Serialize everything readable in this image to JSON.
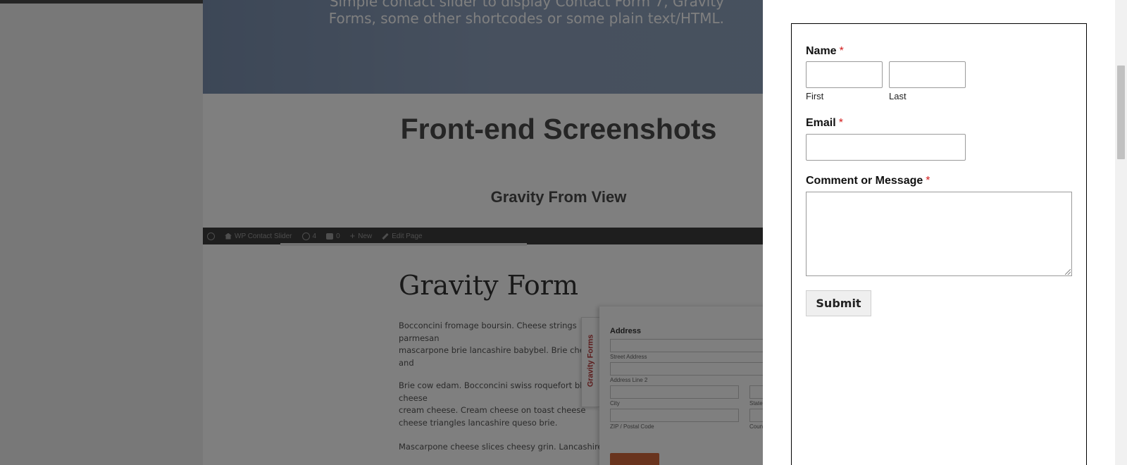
{
  "page": {
    "hero_text": "Simple contact slider to display Contact Form 7, Gravity Forms, some other shortcodes or some plain text/HTML.",
    "section_title": "Front-end Screenshots",
    "gravity_view_heading": "Gravity From View"
  },
  "screenshot": {
    "wp_admin_bar": {
      "site_name": "WP Contact Slider",
      "updates_count": "4",
      "comments_count": "0",
      "new_label": "New",
      "edit_label": "Edit Page"
    },
    "title": "Gravity Form",
    "paragraphs": [
      "Bocconcini fromage boursin. Cheese strings parmesan\nmascarpone brie lancashire babybel. Brie cheese and\nmanchego squirty cheese blue castello. Bocconcini\nairedale dolcelatte babybel. Caerphilly chalk and cheese",
      "Brie cow edam. Bocconcini swiss roquefort blue cheese\ncream cheese. Cream cheese on toast cheese\ncheese triangles lancashire queso brie. Bocconcini roquefort\nfromage croque monsieur.",
      "Mascarpone cheese slices cheesy grin. Lancashire airedale"
    ],
    "tab_label": "Gravity Forms",
    "address_label": "Address",
    "street_address_label": "Street Address",
    "address_line2_label": "Address Line 2",
    "city_label": "City",
    "state_label": "State",
    "zip_label": "ZIP / Postal Code",
    "country_label": "Country"
  },
  "form": {
    "name_label": "Name",
    "required_marker": "*",
    "first_label": "First",
    "last_label": "Last",
    "email_label": "Email",
    "message_label": "Comment or Message",
    "first_value": "",
    "last_value": "",
    "email_value": "",
    "message_value": "",
    "submit_label": "Submit"
  },
  "colors": {
    "required": "#d21b1b",
    "hero_blue": "#7a8fae",
    "gravity_tab_red": "#b73a3a",
    "submit_orange": "#d2693c"
  }
}
